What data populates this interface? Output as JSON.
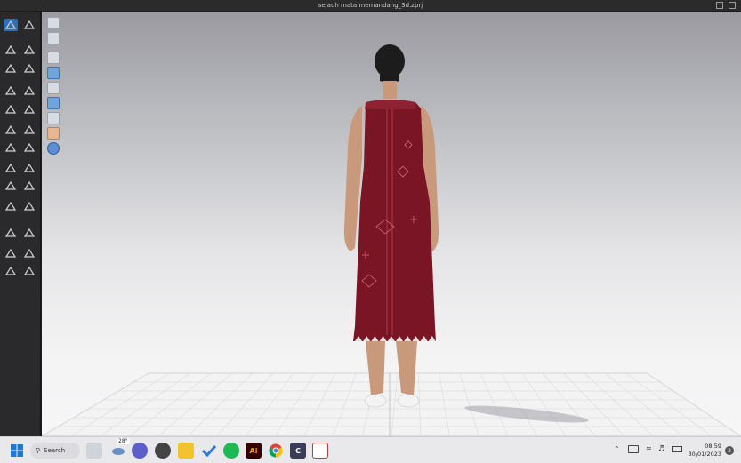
{
  "window": {
    "title": "sejauh mata memandang_3d.zprj"
  },
  "left_toolbar": {
    "tools": [
      "select-icon",
      "transform-icon",
      "edit-pattern-icon",
      "move-icon",
      "segment-icon",
      "arrange-icon",
      "sew-icon",
      "fold-icon",
      "pin-icon",
      "tack-icon",
      "measure-icon",
      "tuck-icon",
      "pen-icon",
      "stitch-icon",
      "texture-icon",
      "trim-icon",
      "button-icon",
      "zipper-icon",
      "brush-icon",
      "layer-icon",
      "avatar-icon",
      "fabric-icon",
      "puckering-icon",
      "topstitch-icon",
      "pleat-icon",
      "elastic-icon"
    ]
  },
  "viewport": {
    "display_tools": [
      "camera-icon",
      "texture-view-icon",
      "pose-icon",
      "show-avatar-icon",
      "show-garment-icon",
      "fit-map-icon",
      "surface-icon",
      "skin-icon",
      "environment-icon"
    ],
    "garment_color": "#7a1526",
    "floor_color": "#f4f4f5"
  },
  "taskbar": {
    "search_label": "Search",
    "weather_temp": "28°",
    "time": "08:59",
    "date": "30/01/2023",
    "notification_count": "2",
    "apps": [
      "windows-start-icon",
      "task-view-icon",
      "weather-icon",
      "teams-icon",
      "clock-app-icon",
      "file-explorer-icon",
      "todo-icon",
      "spotify-icon",
      "illustrator-icon",
      "chrome-icon",
      "clo3d-icon",
      "snipping-icon"
    ],
    "illustrator_label": "Ai"
  }
}
